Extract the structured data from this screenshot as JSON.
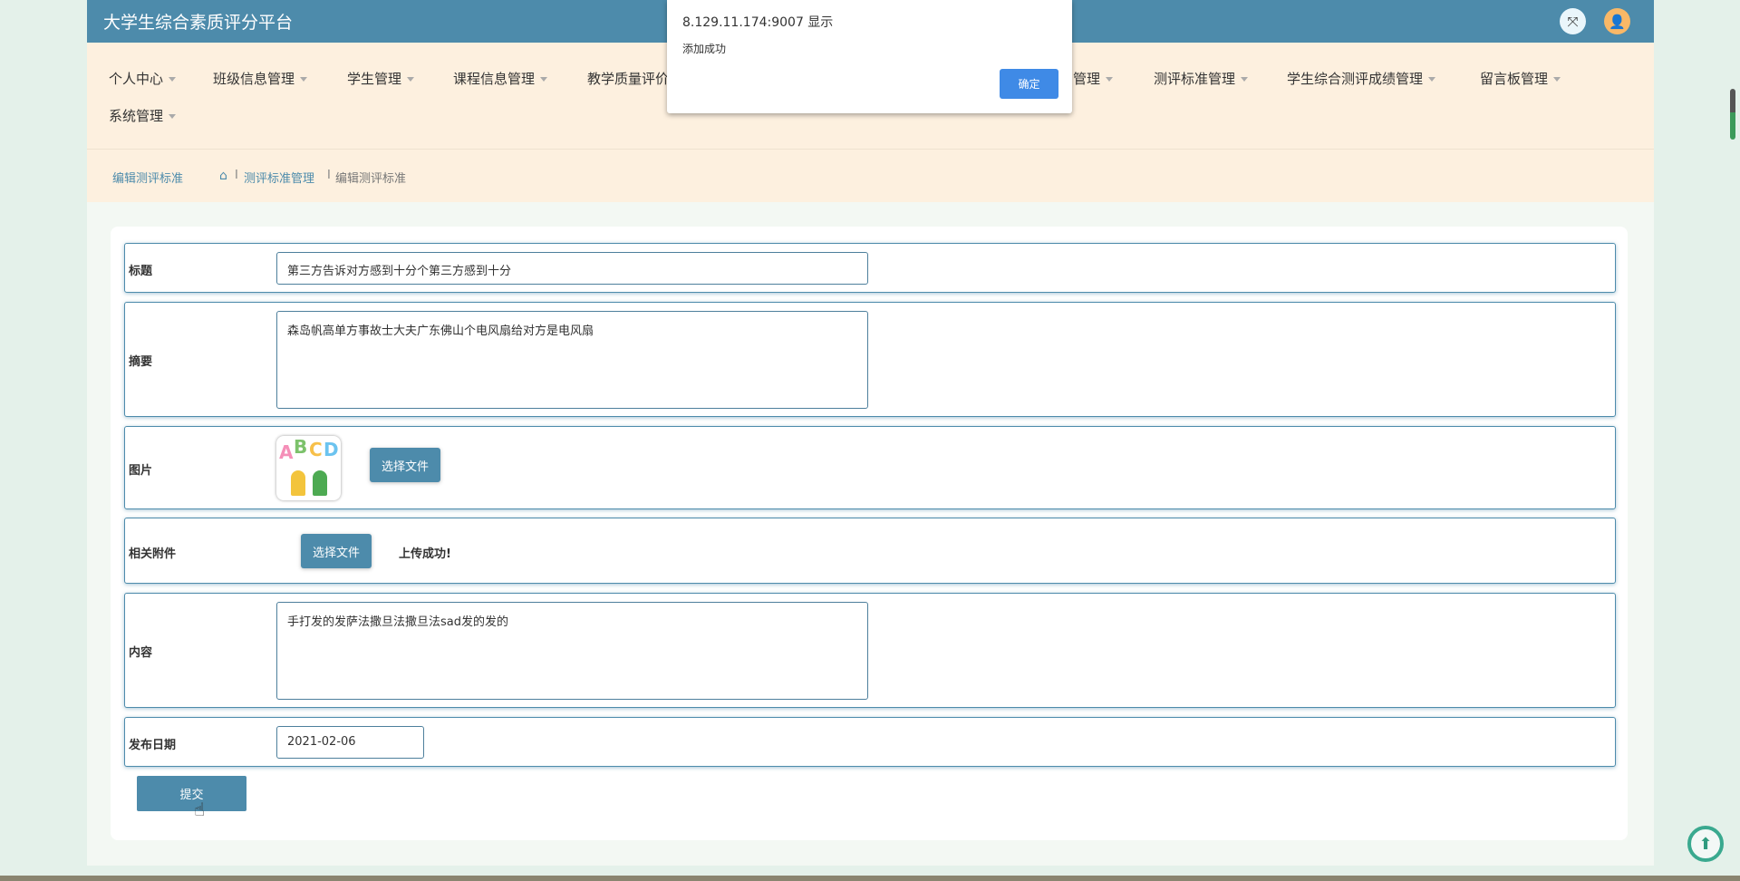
{
  "header": {
    "title": "大学生综合素质评分平台",
    "fullscreen_icon": "fullscreen-icon",
    "user_icon": "user-icon"
  },
  "nav": {
    "items": [
      {
        "label": "个人中心"
      },
      {
        "label": "班级信息管理"
      },
      {
        "label": "学生管理"
      },
      {
        "label": "课程信息管理"
      },
      {
        "label": "教学质量评价管理"
      },
      {
        "label": "管理"
      },
      {
        "label": "测评标准管理"
      },
      {
        "label": "学生综合测评成绩管理"
      },
      {
        "label": "留言板管理"
      },
      {
        "label": "系统管理"
      }
    ]
  },
  "breadcrumb": {
    "page": "编辑测评标准",
    "sep": "I",
    "parent": "测评标准管理",
    "current": "编辑测评标准"
  },
  "form": {
    "title_label": "标题",
    "title_value": "第三方告诉对方感到十分个第三方感到十分",
    "summary_label": "摘要",
    "summary_value": "森岛帆高单方事故士大夫广东佛山个电风扇给对方是电风扇",
    "image_label": "图片",
    "image_button": "选择文件",
    "attachment_label": "相关附件",
    "attachment_button": "选择文件",
    "attachment_status": "上传成功!",
    "content_label": "内容",
    "content_value": "手打发的发萨法撒旦法撒旦法sad发的发的",
    "date_label": "发布日期",
    "date_value": "2021-02-06",
    "submit": "提交"
  },
  "dialog": {
    "origin": "8.129.11.174:9007 显示",
    "message": "添加成功",
    "ok": "确定"
  },
  "colors": {
    "primary": "#4d8bab",
    "nav_bg": "#fdf0df",
    "dialog_ok": "#3f8ae6",
    "back_top": "#3aa98f"
  }
}
